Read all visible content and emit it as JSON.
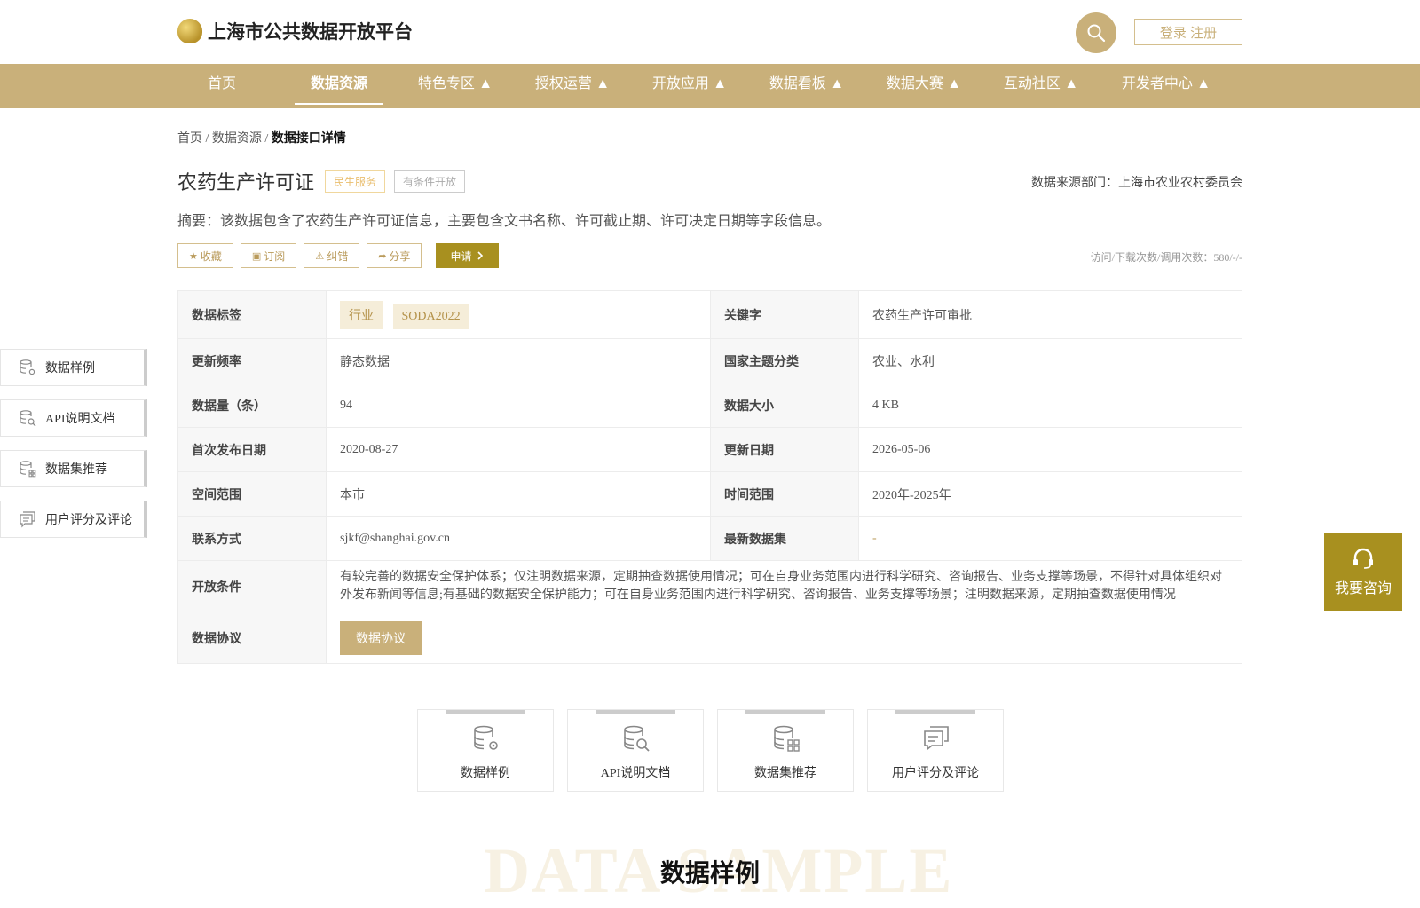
{
  "header": {
    "site_title": "上海市公共数据开放平台",
    "login_label": "登录 注册"
  },
  "nav": [
    {
      "label": "首页"
    },
    {
      "label": "数据资源"
    },
    {
      "label": "特色专区 ▲"
    },
    {
      "label": "授权运营 ▲"
    },
    {
      "label": "开放应用 ▲"
    },
    {
      "label": "数据看板 ▲"
    },
    {
      "label": "数据大赛 ▲"
    },
    {
      "label": "互动社区 ▲"
    },
    {
      "label": "开发者中心 ▲"
    }
  ],
  "breadcrumb": {
    "home": "首页",
    "sep": "/",
    "resources": "数据资源",
    "current": "数据接口详情"
  },
  "dataset": {
    "title": "农药生产许可证",
    "tag_service": "民生服务",
    "tag_open": "有条件开放",
    "source": "数据来源部门：上海市农业农村委员会",
    "summary": "摘要：该数据包含了农药生产许可证信息，主要包含文书名称、许可截止期、许可决定日期等字段信息。",
    "stats": "访问/下载次数/调用次数：580/-/-"
  },
  "actions": {
    "favorite": "收藏",
    "subscribe": "订阅",
    "report": "纠错",
    "share": "分享",
    "apply": "申请"
  },
  "info": {
    "tags_label": "数据标签",
    "tags": [
      "行业",
      "SODA2022"
    ],
    "keyword_label": "关键字",
    "keyword": "农药生产许可审批",
    "freq_label": "更新频率",
    "freq": "静态数据",
    "topic_label": "国家主题分类",
    "topic": "农业、水利",
    "count_label": "数据量（条）",
    "count": "94",
    "size_label": "数据大小",
    "size": "4 KB",
    "first_label": "首次发布日期",
    "first": "2020-08-27",
    "update_label": "更新日期",
    "update": "2026-05-06",
    "space_label": "空间范围",
    "space": "本市",
    "time_label": "时间范围",
    "time": "2020年-2025年",
    "contact_label": "联系方式",
    "contact": "sjkf@shanghai.gov.cn",
    "latest_label": "最新数据集",
    "latest": "-",
    "cond_label": "开放条件",
    "cond": "有较完善的数据安全保护体系；仅注明数据来源，定期抽查数据使用情况；可在自身业务范围内进行科学研究、咨询报告、业务支撑等场景，不得针对具体组织对外发布新闻等信息;有基础的数据安全保护能力；可在自身业务范围内进行科学研究、咨询报告、业务支撑等场景；注明数据来源，定期抽查数据使用情况",
    "proto_label": "数据协议",
    "proto_btn": "数据协议"
  },
  "side_nav": [
    {
      "label": "数据样例"
    },
    {
      "label": "API说明文档"
    },
    {
      "label": "数据集推荐"
    },
    {
      "label": "用户评分及评论"
    }
  ],
  "consult": "我要咨询",
  "cards": [
    {
      "label": "数据样例"
    },
    {
      "label": "API说明文档"
    },
    {
      "label": "数据集推荐"
    },
    {
      "label": "用户评分及评论"
    }
  ],
  "section": {
    "bg_text": "DATA SAMPLE",
    "title": "数据样例"
  }
}
